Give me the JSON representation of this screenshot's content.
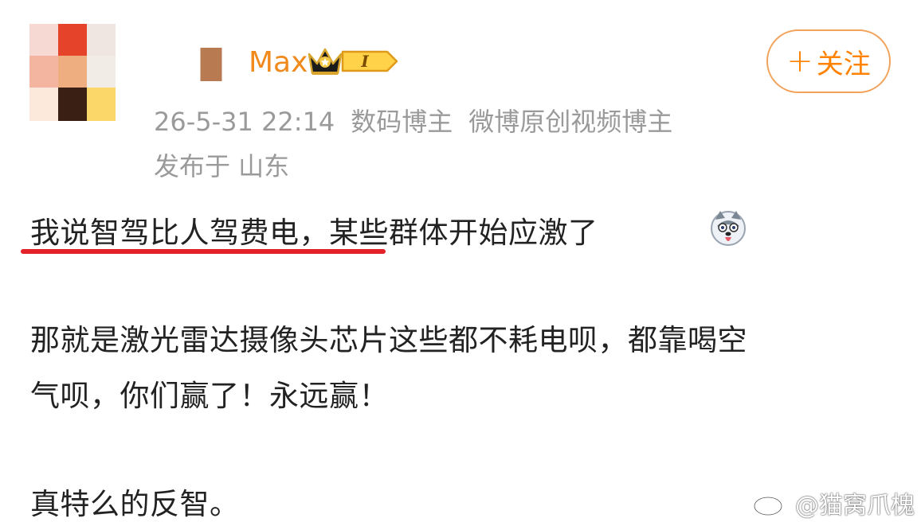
{
  "post": {
    "username_visible": "Max",
    "badge_level": "I",
    "follow_label": "关注",
    "follow_plus": "+",
    "timestamp": "26-5-31 22:14",
    "tag1": "数码博主",
    "tag2": "微博原创视频博主",
    "location": "发布于 山东",
    "lines": [
      "我说智驾比人驾费电，某些群体开始应激了",
      "那就是激光雷达摄像头芯片这些都不耗电呗，都靠喝空",
      "气呗，你们赢了！永远赢！",
      "真特么的反智。"
    ]
  },
  "watermark": {
    "text": "@猫窝爪槐"
  },
  "colors": {
    "accent": "#ff8200",
    "follow_border": "#f3a25a",
    "meta_text": "#9a9a9a",
    "underline": "#e3222a",
    "username": "#f08a1c"
  }
}
